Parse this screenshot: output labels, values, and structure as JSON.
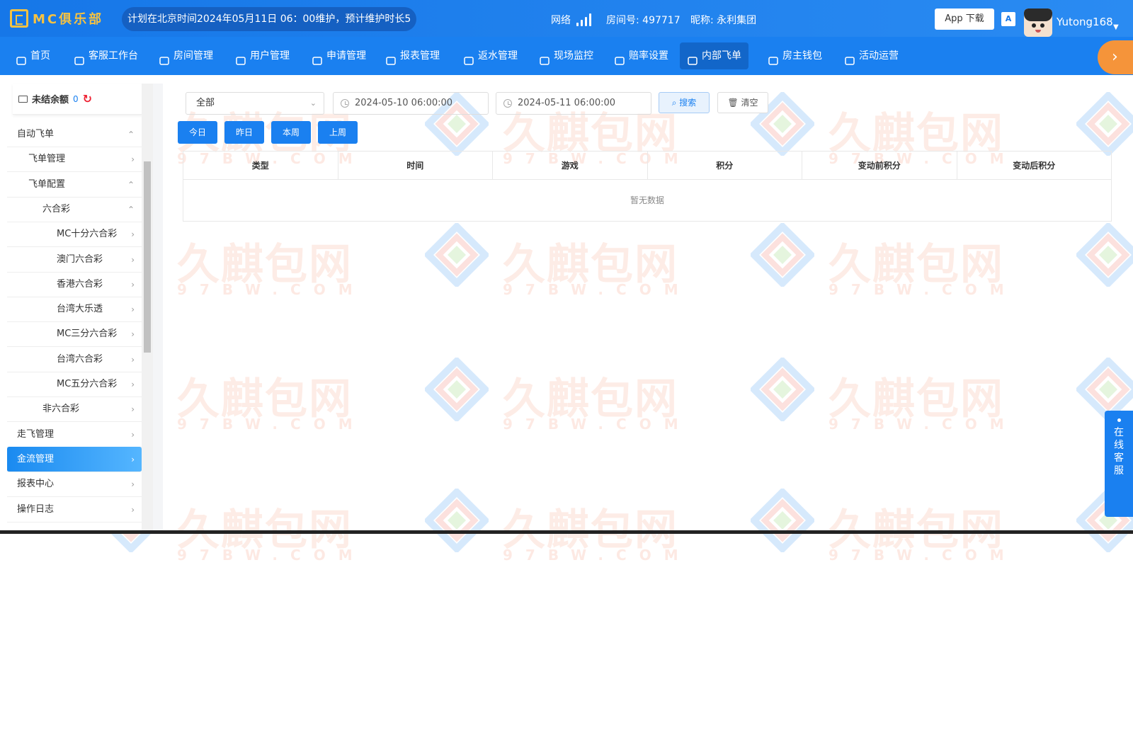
{
  "header": {
    "logo_text": "MC俱乐部",
    "marquee": "计划在北京时间2024年05月11日 06：00维护，预计维护时长5",
    "network_label": "网络",
    "room_label": "房间号: 497717",
    "nickname_label": "昵称: 永利集团",
    "app_download": "App 下载",
    "translate_icon": "A",
    "username": "Yutong168"
  },
  "nav": {
    "items": [
      {
        "label": "首页",
        "icon": "home-icon"
      },
      {
        "label": "客服工作台",
        "icon": "headset-icon"
      },
      {
        "label": "房间管理",
        "icon": "grid-icon"
      },
      {
        "label": "用户管理",
        "icon": "user-icon"
      },
      {
        "label": "申请管理",
        "icon": "document-icon"
      },
      {
        "label": "报表管理",
        "icon": "bar-chart-icon"
      },
      {
        "label": "返水管理",
        "icon": "tag-icon"
      },
      {
        "label": "现场监控",
        "icon": "monitor-icon"
      },
      {
        "label": "赔率设置",
        "icon": "shield-icon"
      },
      {
        "label": "内部飞单",
        "icon": "refresh-clock-icon",
        "active": true
      },
      {
        "label": "房主钱包",
        "icon": "wallet-icon"
      },
      {
        "label": "活动运营",
        "icon": "activity-icon"
      }
    ],
    "more_icon": "›"
  },
  "sidebar": {
    "balance_label": "未结余额",
    "balance_value": "0",
    "items": [
      {
        "label": "自动飞单",
        "chev": "^"
      },
      {
        "label": "飞单管理",
        "chev": ">"
      },
      {
        "label": "飞单配置",
        "chev": "^"
      },
      {
        "label": "六合彩",
        "chev": "^"
      },
      {
        "label": "MC十分六合彩",
        "chev": ">"
      },
      {
        "label": "澳门六合彩",
        "chev": ">"
      },
      {
        "label": "香港六合彩",
        "chev": ">"
      },
      {
        "label": "台湾大乐透",
        "chev": ">"
      },
      {
        "label": "MC三分六合彩",
        "chev": ">"
      },
      {
        "label": "台湾六合彩",
        "chev": ">"
      },
      {
        "label": "MC五分六合彩",
        "chev": ">"
      },
      {
        "label": "非六合彩",
        "chev": ">"
      },
      {
        "label": "走飞管理",
        "chev": ">"
      },
      {
        "label": "金流管理",
        "chev": ">",
        "active": true
      },
      {
        "label": "报表中心",
        "chev": ">"
      },
      {
        "label": "操作日志",
        "chev": ">"
      }
    ]
  },
  "filters": {
    "type_select": "全部",
    "start_date": "2024-05-10 06:00:00",
    "end_date": "2024-05-11 06:00:00",
    "search_label": "搜索",
    "clear_label": "清空",
    "quick": [
      "今日",
      "昨日",
      "本周",
      "上周"
    ]
  },
  "table": {
    "columns": [
      "类型",
      "时间",
      "游戏",
      "积分",
      "变动前积分",
      "变动后积分"
    ],
    "empty_text": "暂无数据"
  },
  "customer_service": "在线客服",
  "watermark": {
    "text": "久麒包网",
    "sub": "97BW.COM"
  }
}
